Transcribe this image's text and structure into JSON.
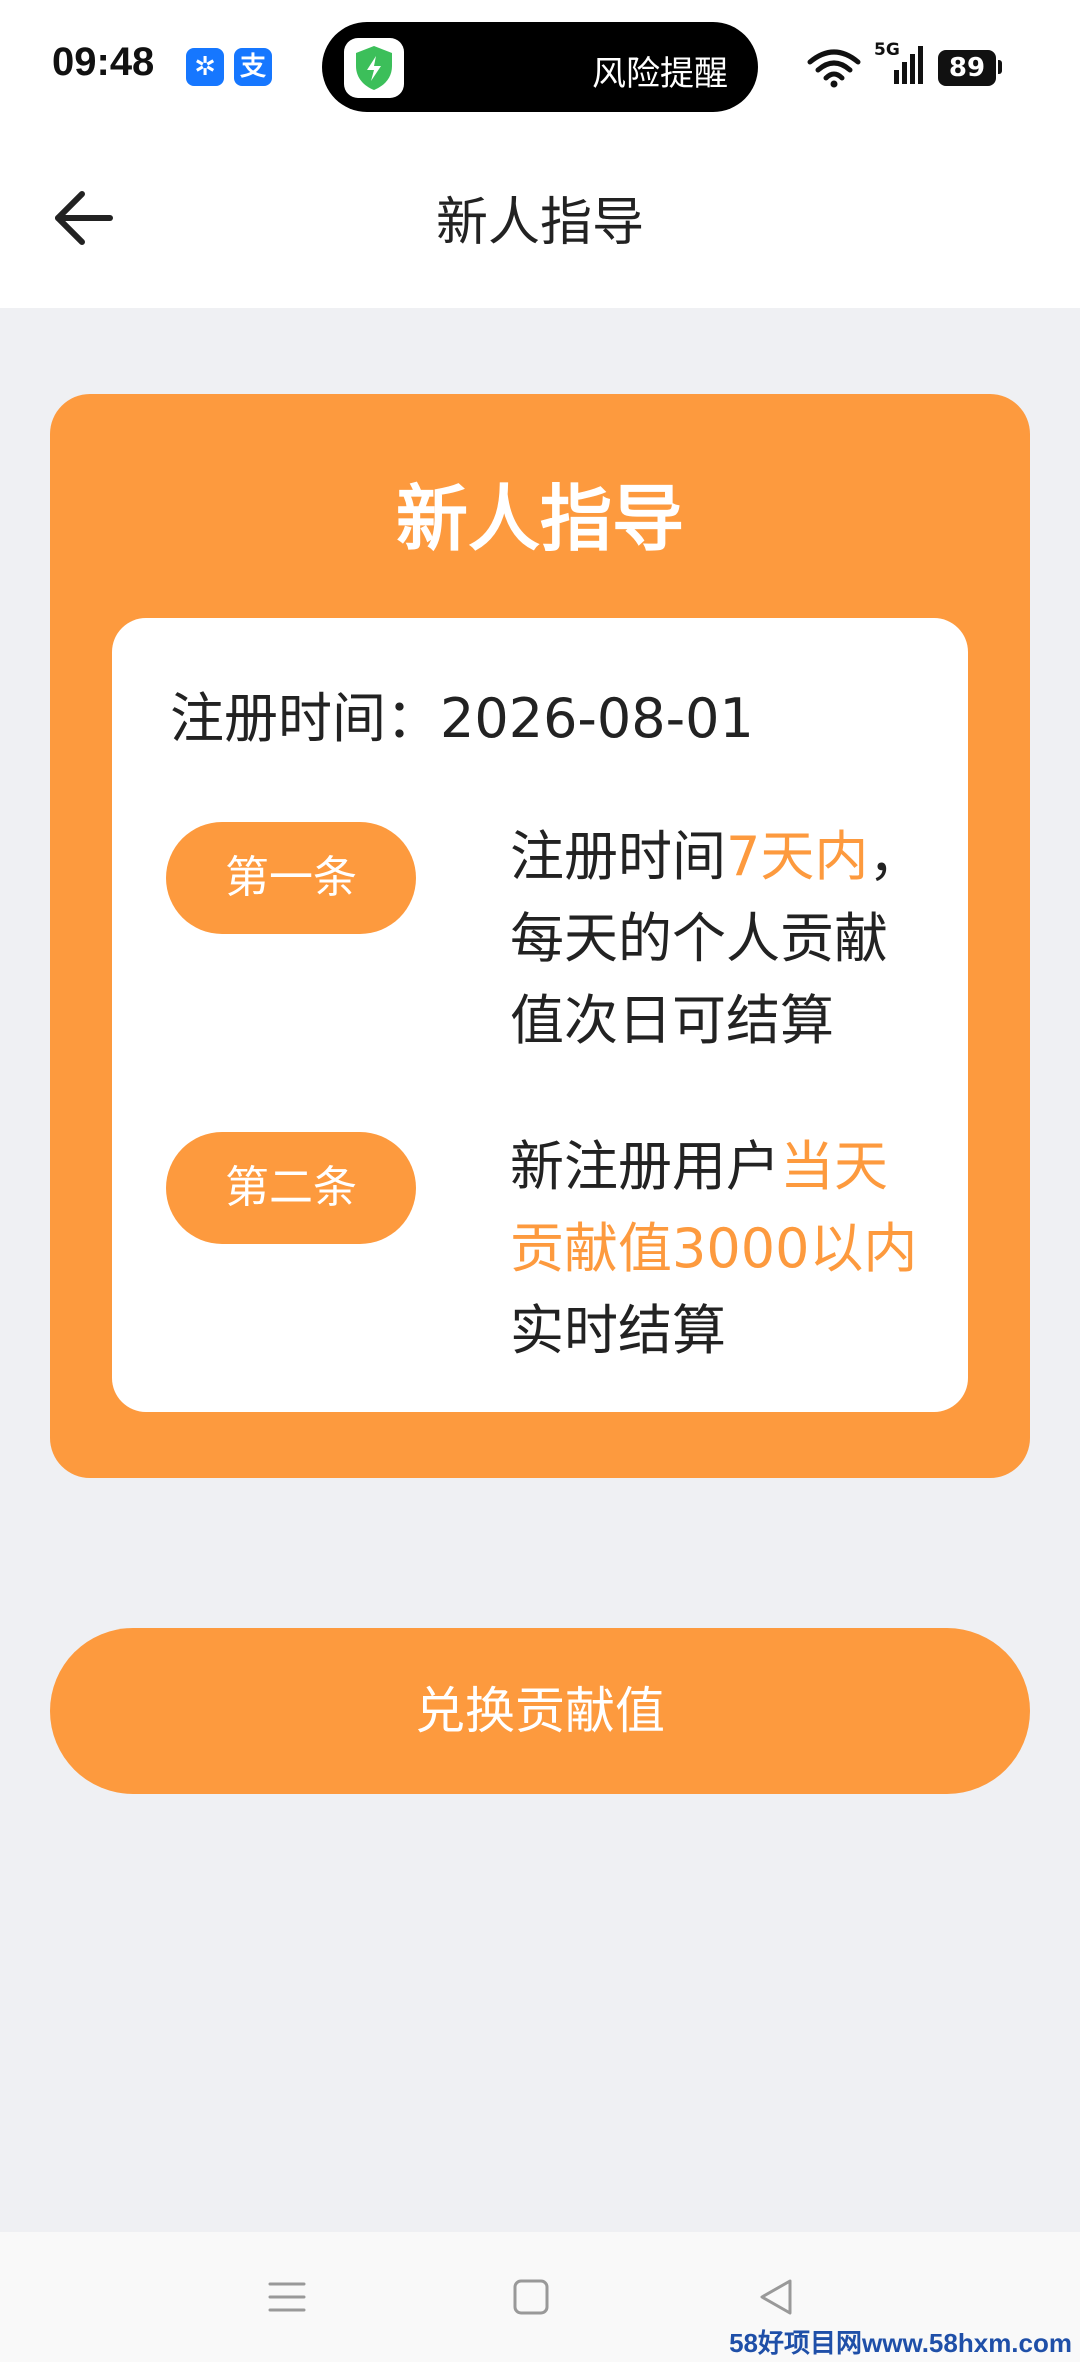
{
  "status_bar": {
    "time": "09:48",
    "island_text": "风险提醒",
    "network": "5G",
    "battery": "89",
    "icons": [
      "pinwheel-icon",
      "alipay-icon",
      "shield-icon",
      "wifi-icon",
      "signal-icon",
      "battery-icon"
    ]
  },
  "header": {
    "title": "新人指导"
  },
  "card": {
    "title": "新人指导",
    "registration": "注册时间：2026-08-01",
    "rules": [
      {
        "badge": "第一条",
        "line1_pre": "注册时间",
        "line1_hl": "7天内",
        "line1_post": "，",
        "line2": "每天的个人贡献",
        "line3": "值次日可结算"
      },
      {
        "badge": "第二条",
        "line1_pre": "新注册用户",
        "line1_hl": "当天",
        "line2_hl": "贡献值3000以内",
        "line3": "实时结算"
      }
    ]
  },
  "actions": {
    "exchange_label": "兑换贡献值"
  },
  "watermark": "58好项目网www.58hxm.com",
  "colors": {
    "accent": "#fd9a3e",
    "page_bg": "#eff0f3",
    "text": "#222222"
  }
}
